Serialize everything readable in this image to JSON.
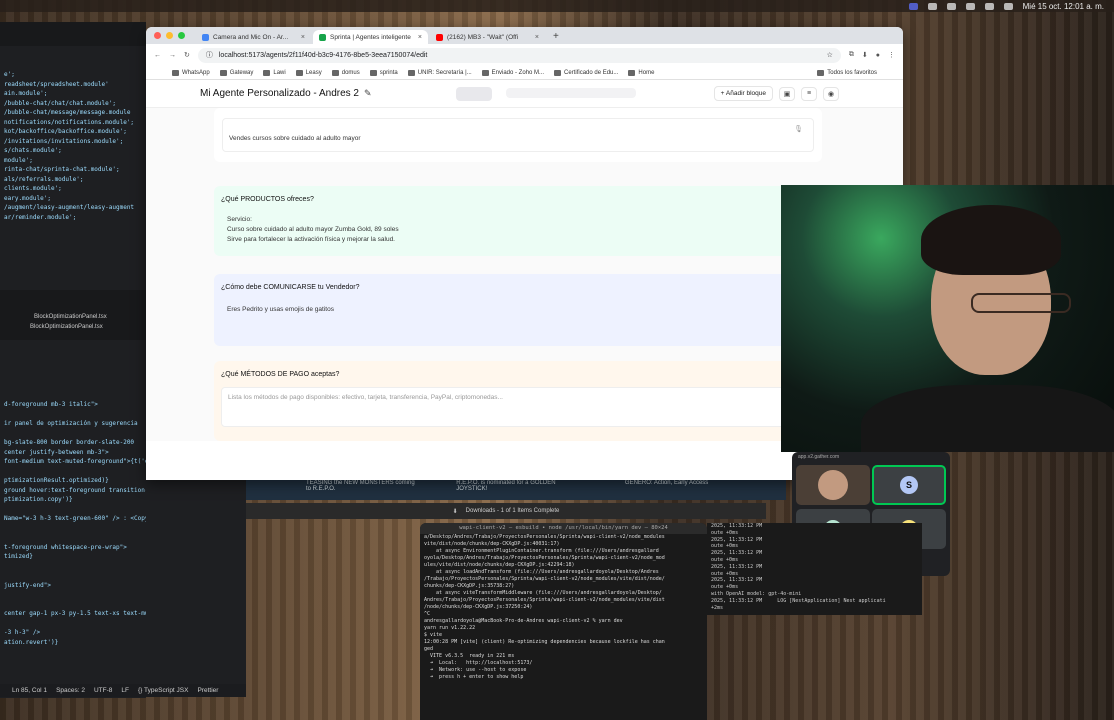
{
  "menubar": {
    "clock": "Mié 15 oct.  12:01 a. m."
  },
  "editor": {
    "lines": [
      "e';",
      "readsheet/spreadsheet.module'",
      "ain.module';",
      "/bubble-chat/chat/chat.module';",
      "/bubble-chat/message/message.module",
      "notifications/notifications.module';",
      "kot/backoffice/backoffice.module';",
      "/invitations/invitations.module';",
      "s/chats.module';",
      "module';",
      "rinta-chat/sprinta-chat.module';",
      "als/referrals.module';",
      "clients.module';",
      "eary.module';",
      "/augment/leasy-augment/leasy-augment",
      "ar/reminder.module';"
    ],
    "tabs": [
      "BlockOptimizationPanel.tsx",
      "BlockOptimizationPanel.tsx"
    ],
    "lines2": [
      "d-foreground mb-3 italic\">",
      "",
      "ir panel de optimización y sugerencia",
      "",
      "bg-slate-800 border border-slate-200",
      "center justify-between mb-3\">",
      " font-medium text-muted-foreground\">{t('edit.edito",
      "",
      "ptimizationResult.optimized)}",
      "ground hover:text-foreground transition-colors",
      "ptimization.copy')}",
      "",
      "Name=\"w-3 h-3 text-green-600\" /> : <Copy className",
      "",
      "",
      "t-foreground whitespace-pre-wrap\">",
      "timized}",
      "",
      "",
      " justify-end\">",
      "",
      "",
      "center gap-1 px-3 py-1.5 text-xs text-muted-foregrou",
      "",
      "-3 h-3\" />",
      "ation.revert')}"
    ],
    "status": [
      "Ln 85, Col 1",
      "Spaces: 2",
      "UTF-8",
      "LF",
      "{} TypeScript JSX",
      "Prettier"
    ]
  },
  "browser": {
    "tabs": [
      {
        "label": "Camera and Mic On - Ar...",
        "color": "#4285f4"
      },
      {
        "label": "Sprinta | Agentes inteligente",
        "color": "#16a34a"
      },
      {
        "label": "(2162) MB3 - \"Wait\" (Offi",
        "color": "#ff0000"
      }
    ],
    "url": "localhost:5173/agents/2f11f40d-b3c9-4176-8be5-3eea7150074/edit",
    "bookmarks": [
      "WhatsApp",
      "Gateway",
      "Lawi",
      "Leasy",
      "domus",
      "sprinta",
      "UNIR: Secretaría |...",
      "Enviado - Zoho M...",
      "Certificado de Edu...",
      "Home"
    ],
    "bookmarks_right": "Todos los favoritos"
  },
  "app": {
    "title": "Mi Agente Personalizado - Andres 2",
    "add_block": "+ Añadir bloque",
    "blocks": [
      {
        "label": "",
        "value": "Vendes cursos sobre cuidado al adulto mayor"
      },
      {
        "label": "¿Qué PRODUCTOS ofreces?",
        "value": "Servicio:\nCurso sobre cuidado al adulto mayor Zumba Gold, 89 soles\nSirve para fortalecer la activación física y mejorar la salud."
      },
      {
        "label": "¿Cómo debe COMUNICARSE tu Vendedor?",
        "value": "Eres Pedrito y usas emojis de gatitos"
      },
      {
        "label": "¿Qué MÉTODOS DE PAGO aceptas?",
        "placeholder": "Lista los métodos de pago disponibles: efectivo, tarjeta, transferencia, PayPal, criptomonedas..."
      }
    ],
    "colors": {
      "products_bg": "#ecfdf5",
      "communicate_bg": "#eef2ff",
      "payment_bg": "#fff7ed"
    }
  },
  "meet": {
    "header": "app.v2.gather.com",
    "participants": [
      "S",
      "A",
      "B"
    ]
  },
  "downloads": "Downloads - 1 of 1 Items Complete",
  "steam": [
    "TEASING the NEW MONSTERS coming to R.E.P.O.",
    "R.E.P.O. is nominated for a GOLDEN JOYSTICK!",
    "GÉNERO: Action, Early Access"
  ],
  "terminal": {
    "title": "wapi-client-v2 — esbuild • node /usr/local/bin/yarn dev — 80×24",
    "lines": [
      "a/Desktop/Andres/Trabajo/ProyectosPersonales/Sprinta/wapi-client-v2/node_modules",
      "vite/dist/node/chunks/dep-CKXgDP.js:40031:17)",
      "    at async EnvironmentPluginContainer.transform (file:///Users/andresgallard",
      "oyola/Desktop/Andres/Trabajo/ProyectosPersonales/Sprinta/wapi-client-v2/node_mod",
      "ules/vite/dist/node/chunks/dep-CKXgDP.js:42294:18)",
      "    at async loadAndTransform (file:///Users/andresgallardoyola/Desktop/Andres",
      "/Trabajo/ProyectosPersonales/Sprinta/wapi-client-v2/node_modules/vite/dist/node/",
      "chunks/dep-CKXgDP.js:35738:27)",
      "    at async viteTransformMiddleware (file:///Users/andresgallardoyola/Desktop/",
      "Andres/Trabajo/ProyectosPersonales/Sprinta/wapi-client-v2/node_modules/vite/dist",
      "/node/chunks/dep-CKXgDP.js:37250:24)",
      "^C",
      "andresgallardoyola@MacBook-Pro-de-Andres wapi-client-v2 % yarn dev",
      "yarn run v1.22.22",
      "$ vite",
      "12:00:28 PM [vite] (client) Re-optimizing dependencies because lockfile has chan",
      "ged",
      "",
      "  VITE v6.3.5  ready in 221 ms",
      "",
      "  ➜  Local:   http://localhost:5173/",
      "  ➜  Network: use --host to expose",
      "  ➜  press h + enter to show help"
    ]
  },
  "terminal2": {
    "lines": [
      "2025, 11:33:12 PM",
      "oute +0ms",
      "2025, 11:33:12 PM",
      "oute +0ms",
      "2025, 11:33:12 PM",
      "oute +0ms",
      "2025, 11:33:12 PM",
      "oute +0ms",
      "2025, 11:33:12 PM",
      "oute +0ms",
      "with OpenAI model: gpt-4o-mini",
      "2025, 11:33:12 PM     LOG [NestApplication] Nest applicati",
      "+2ms"
    ]
  }
}
